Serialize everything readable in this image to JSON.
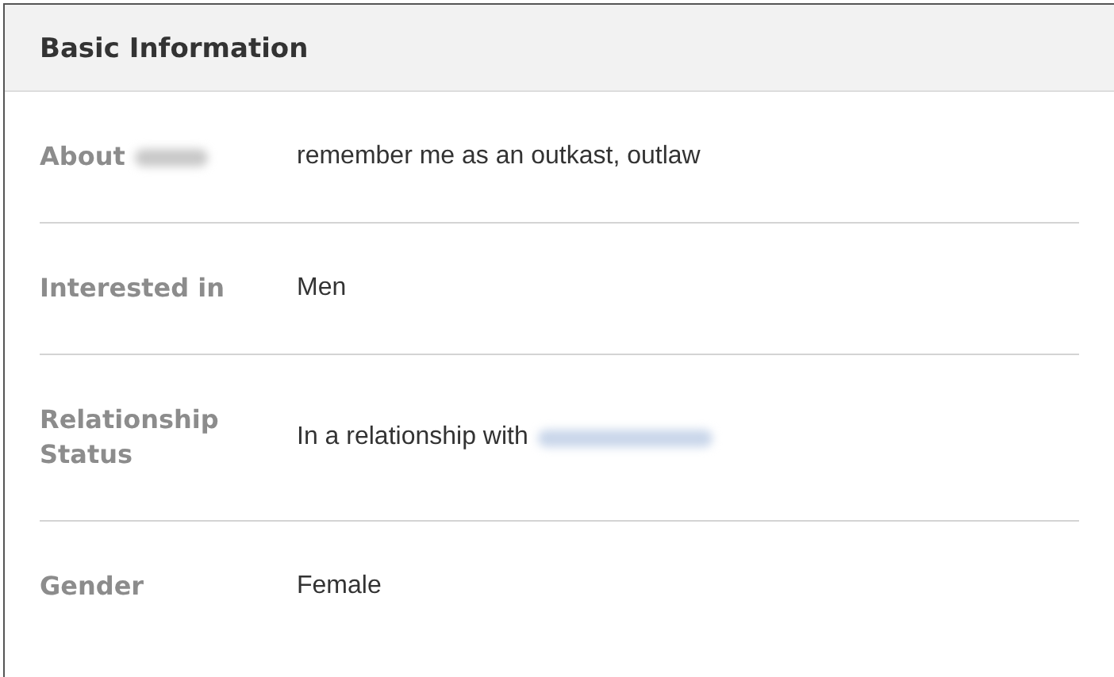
{
  "section": {
    "title": "Basic Information"
  },
  "rows": [
    {
      "label": "About",
      "label_redacted": true,
      "value": "remember me as an outkast, outlaw",
      "value_redacted": false
    },
    {
      "label": "Interested in",
      "label_redacted": false,
      "value": "Men",
      "value_redacted": false
    },
    {
      "label": "Relationship Status",
      "label_redacted": false,
      "value": "In a relationship with",
      "value_redacted": true
    },
    {
      "label": "Gender",
      "label_redacted": false,
      "value": "Female",
      "value_redacted": false
    }
  ]
}
